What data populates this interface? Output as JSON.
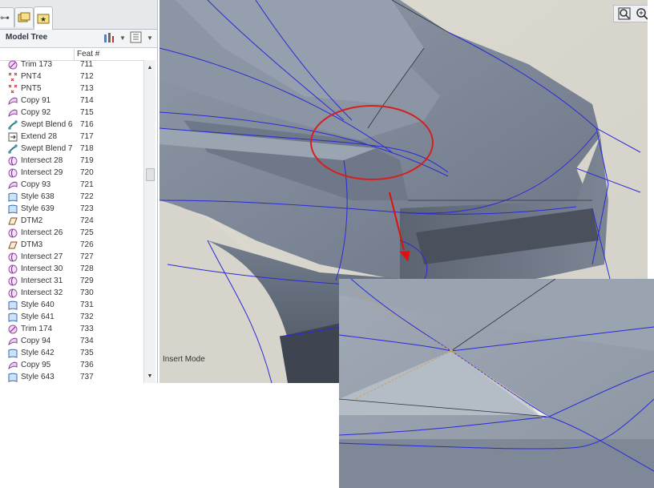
{
  "model_tree": {
    "title": "Model Tree",
    "column_feat": "Feat #",
    "items": [
      {
        "name": "Trim 173",
        "num": "711",
        "icon": "trim-icon"
      },
      {
        "name": "PNT4",
        "num": "712",
        "icon": "datum-point-icon"
      },
      {
        "name": "PNT5",
        "num": "713",
        "icon": "datum-point-icon"
      },
      {
        "name": "Copy 91",
        "num": "714",
        "icon": "copy-icon"
      },
      {
        "name": "Copy 92",
        "num": "715",
        "icon": "copy-icon"
      },
      {
        "name": "Swept Blend 6",
        "num": "716",
        "icon": "swept-blend-icon"
      },
      {
        "name": "Extend 28",
        "num": "717",
        "icon": "extend-icon"
      },
      {
        "name": "Swept Blend 7",
        "num": "718",
        "icon": "swept-blend-icon"
      },
      {
        "name": "Intersect 28",
        "num": "719",
        "icon": "intersect-icon"
      },
      {
        "name": "Intersect 29",
        "num": "720",
        "icon": "intersect-icon"
      },
      {
        "name": "Copy 93",
        "num": "721",
        "icon": "copy-icon"
      },
      {
        "name": "Style 638",
        "num": "722",
        "icon": "style-icon"
      },
      {
        "name": "Style 639",
        "num": "723",
        "icon": "style-icon"
      },
      {
        "name": "DTM2",
        "num": "724",
        "icon": "datum-plane-icon"
      },
      {
        "name": "Intersect 26",
        "num": "725",
        "icon": "intersect-icon"
      },
      {
        "name": "DTM3",
        "num": "726",
        "icon": "datum-plane-icon"
      },
      {
        "name": "Intersect 27",
        "num": "727",
        "icon": "intersect-icon"
      },
      {
        "name": "Intersect 30",
        "num": "728",
        "icon": "intersect-icon"
      },
      {
        "name": "Intersect 31",
        "num": "729",
        "icon": "intersect-icon"
      },
      {
        "name": "Intersect 32",
        "num": "730",
        "icon": "intersect-icon"
      },
      {
        "name": "Style 640",
        "num": "731",
        "icon": "style-icon"
      },
      {
        "name": "Style 641",
        "num": "732",
        "icon": "style-icon"
      },
      {
        "name": "Trim 174",
        "num": "733",
        "icon": "trim-icon"
      },
      {
        "name": "Copy 94",
        "num": "734",
        "icon": "copy-icon"
      },
      {
        "name": "Style 642",
        "num": "735",
        "icon": "style-icon"
      },
      {
        "name": "Copy 95",
        "num": "736",
        "icon": "copy-icon"
      },
      {
        "name": "Style 643",
        "num": "737",
        "icon": "style-icon"
      }
    ]
  },
  "viewport": {
    "status_text": "Insert Mode",
    "toolbar_icons": [
      "zoom-fit-icon",
      "zoom-in-icon",
      "zoom-out-icon",
      "refit-icon",
      "display-style-icon",
      "saved-views-icon",
      "perspective-icon",
      "datum-display-icon",
      "point-display-icon",
      "csys-display-icon"
    ]
  },
  "colors": {
    "curve": "#2a2ad8",
    "highlight_circle": "#d42020",
    "arrow": "#e01010",
    "edge_highlight": "#c9a06a"
  }
}
